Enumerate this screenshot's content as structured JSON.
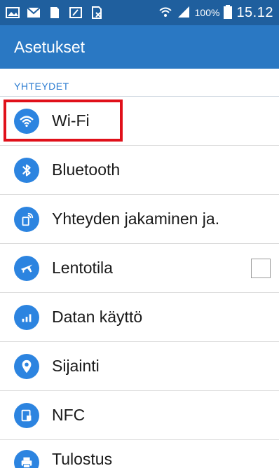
{
  "status": {
    "battery": "100%",
    "time": "15.12"
  },
  "app": {
    "title": "Asetukset"
  },
  "section": {
    "title": "YHTEYDET"
  },
  "items": [
    {
      "label": "Wi-Fi",
      "icon": "wifi-icon"
    },
    {
      "label": "Bluetooth",
      "icon": "bluetooth-icon"
    },
    {
      "label": "Yhteyden jakaminen ja.",
      "icon": "tethering-icon"
    },
    {
      "label": "Lentotila",
      "icon": "airplane-icon"
    },
    {
      "label": "Datan käyttö",
      "icon": "data-usage-icon"
    },
    {
      "label": "Sijainti",
      "icon": "location-icon"
    },
    {
      "label": "NFC",
      "icon": "nfc-icon"
    },
    {
      "label": "Tulostus",
      "icon": "print-icon"
    }
  ],
  "colors": {
    "statusbar": "#1f5f9e",
    "appbar": "#2a78c3",
    "accent": "#2d7dd2",
    "icon_bg": "#2c84e0",
    "highlight": "#e0101a"
  }
}
